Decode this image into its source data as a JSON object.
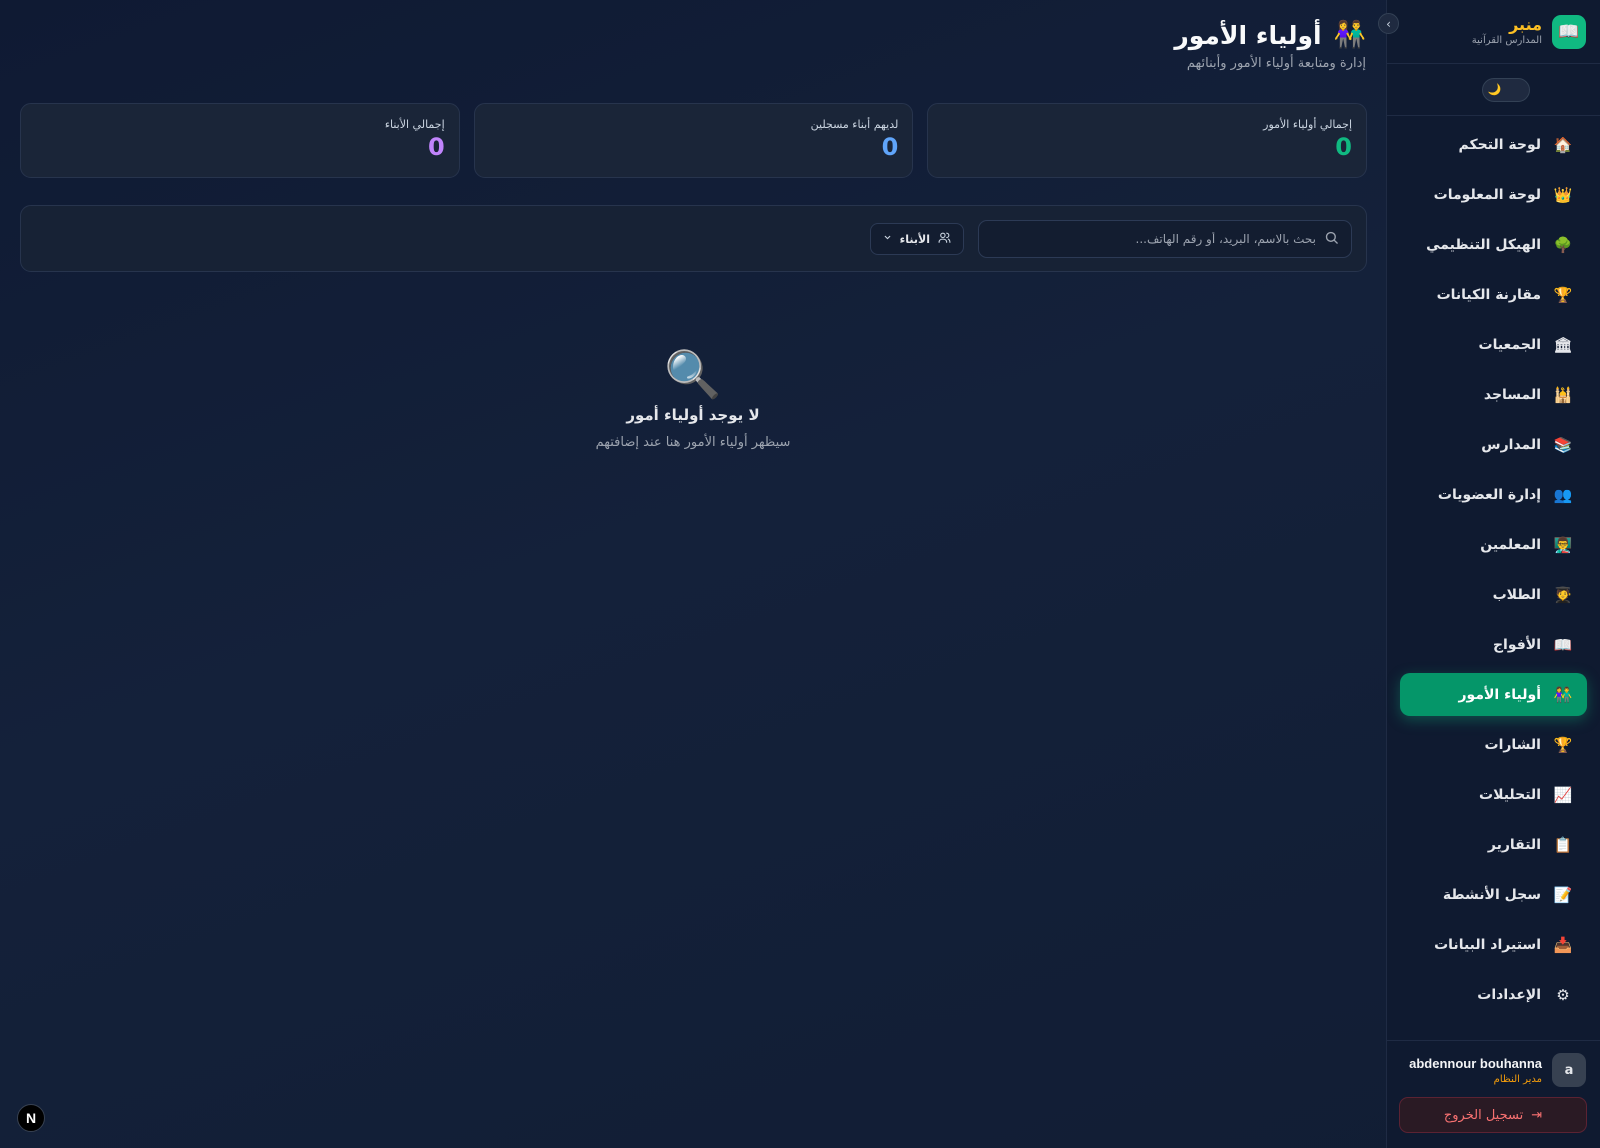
{
  "brand": {
    "name": "منبر",
    "subtitle": "المدارس القرآنية",
    "logo_icon": "📖"
  },
  "collapse_icon": "›",
  "theme_toggle_icon": "🌙",
  "sidebar": {
    "items": [
      {
        "label": "لوحة التحكم",
        "icon": "🏠",
        "active": false
      },
      {
        "label": "لوحة المعلومات",
        "icon": "👑",
        "active": false
      },
      {
        "label": "الهيكل التنظيمي",
        "icon": "🌳",
        "active": false
      },
      {
        "label": "مقارنة الكيانات",
        "icon": "🏆",
        "active": false
      },
      {
        "label": "الجمعيات",
        "icon": "🏛",
        "active": false
      },
      {
        "label": "المساجد",
        "icon": "🕌",
        "active": false
      },
      {
        "label": "المدارس",
        "icon": "📚",
        "active": false
      },
      {
        "label": "إدارة العضويات",
        "icon": "👥",
        "active": false
      },
      {
        "label": "المعلمين",
        "icon": "👨‍🏫",
        "active": false
      },
      {
        "label": "الطلاب",
        "icon": "🧑‍🎓",
        "active": false
      },
      {
        "label": "الأفواج",
        "icon": "📖",
        "active": false
      },
      {
        "label": "أولياء الأمور",
        "icon": "👫",
        "active": true
      },
      {
        "label": "الشارات",
        "icon": "🏆",
        "active": false
      },
      {
        "label": "التحليلات",
        "icon": "📈",
        "active": false
      },
      {
        "label": "التقارير",
        "icon": "📋",
        "active": false
      },
      {
        "label": "سجل الأنشطة",
        "icon": "📝",
        "active": false
      },
      {
        "label": "استيراد البيانات",
        "icon": "📥",
        "active": false
      },
      {
        "label": "الإعدادات",
        "icon": "⚙",
        "active": false
      }
    ]
  },
  "user": {
    "name": "abdennour bouhanna",
    "role": "مدير النظام",
    "avatar_letter": "a"
  },
  "logout": {
    "label": "تسجيل الخروج",
    "icon": "⇥"
  },
  "header": {
    "title": "أولياء الأمور",
    "title_icon": "👫",
    "subtitle": "إدارة ومتابعة أولياء الأمور وأبنائهم"
  },
  "stats": [
    {
      "label": "إجمالي أولياء الأمور",
      "value": "0",
      "color": "#10b981"
    },
    {
      "label": "لديهم أبناء مسجلين",
      "value": "0",
      "color": "#60a5fa"
    },
    {
      "label": "إجمالي الأبناء",
      "value": "0",
      "color": "#c084fc"
    }
  ],
  "search": {
    "placeholder": "بحث بالاسم، البريد، أو رقم الهاتف...",
    "value": ""
  },
  "children_filter": {
    "label": "الأبناء"
  },
  "empty_state": {
    "icon": "🔍",
    "title": "لا يوجد أولياء أمور",
    "subtitle": "سيظهر أولياء الأمور هنا عند إضافتهم"
  },
  "framework_badge": "N",
  "colors": {
    "accent": "#059669",
    "warning": "#f59e0b",
    "danger": "#f87171"
  }
}
